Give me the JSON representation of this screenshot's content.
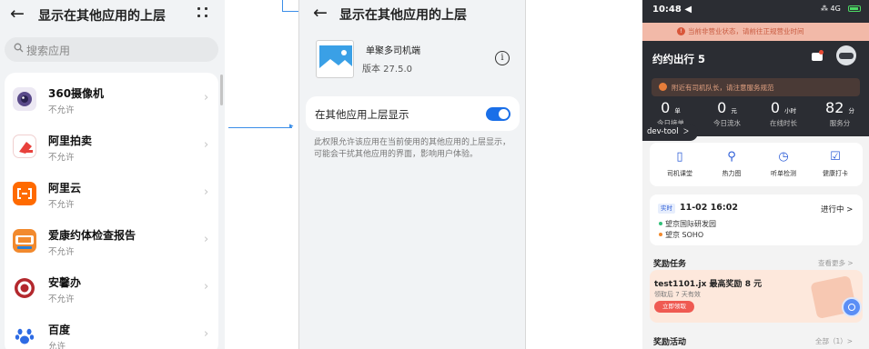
{
  "settings_list": {
    "title": "显示在其他应用的上层",
    "search_placeholder": "搜索应用",
    "apps": [
      {
        "name": "360摄像机",
        "status": "不允许"
      },
      {
        "name": "阿里拍卖",
        "status": "不允许"
      },
      {
        "name": "阿里云",
        "status": "不允许"
      },
      {
        "name": "爱康约体检查报告",
        "status": "不允许"
      },
      {
        "name": "安馨办",
        "status": "不允许"
      },
      {
        "name": "百度",
        "status": "允许"
      }
    ]
  },
  "permission_detail": {
    "title": "显示在其他应用的上层",
    "app_name": "单聚多司机端",
    "app_version": "版本 27.5.0",
    "toggle_label": "在其他应用上层显示",
    "toggle_on": true,
    "description": "此权限允许该应用在当前使用的其他应用的上层显示，可能会干扰其他应用的界面，影响用户体验。"
  },
  "driver_app": {
    "status_time": "10:48 ◀",
    "status_right": "⁂ 4G",
    "notice": "当前非营业状态，请前往正规营业时间",
    "brand": "约约出行 5",
    "tip": "附近有司机队长，请注意服务规范",
    "stats": [
      {
        "value": "0",
        "unit": "单",
        "label": "今日接单"
      },
      {
        "value": "0",
        "unit": "元",
        "label": "今日流水"
      },
      {
        "value": "0",
        "unit": "小时",
        "label": "在线时长"
      },
      {
        "value": "82",
        "unit": "分",
        "label": "服务分"
      }
    ],
    "dev_tool": "dev-tool",
    "tools": [
      {
        "icon": "▯",
        "label": "司机课堂"
      },
      {
        "icon": "⚲",
        "label": "热力图"
      },
      {
        "icon": "◷",
        "label": "听单检测"
      },
      {
        "icon": "☑",
        "label": "健康打卡"
      }
    ],
    "order": {
      "tag": "实时",
      "time": "11-02 16:02",
      "status": "进行中 >",
      "from": "望京国际研发园",
      "to": "望京 SOHO"
    },
    "reward_section": "奖励任务",
    "reward_more": "查看更多 >",
    "reward_title": "test1101.jx 最高奖励 8 元",
    "reward_sub": "领取后 7 天有效",
    "reward_button": "立即领取",
    "activity_section": "奖励活动",
    "activity_more": "全部（1）>"
  }
}
